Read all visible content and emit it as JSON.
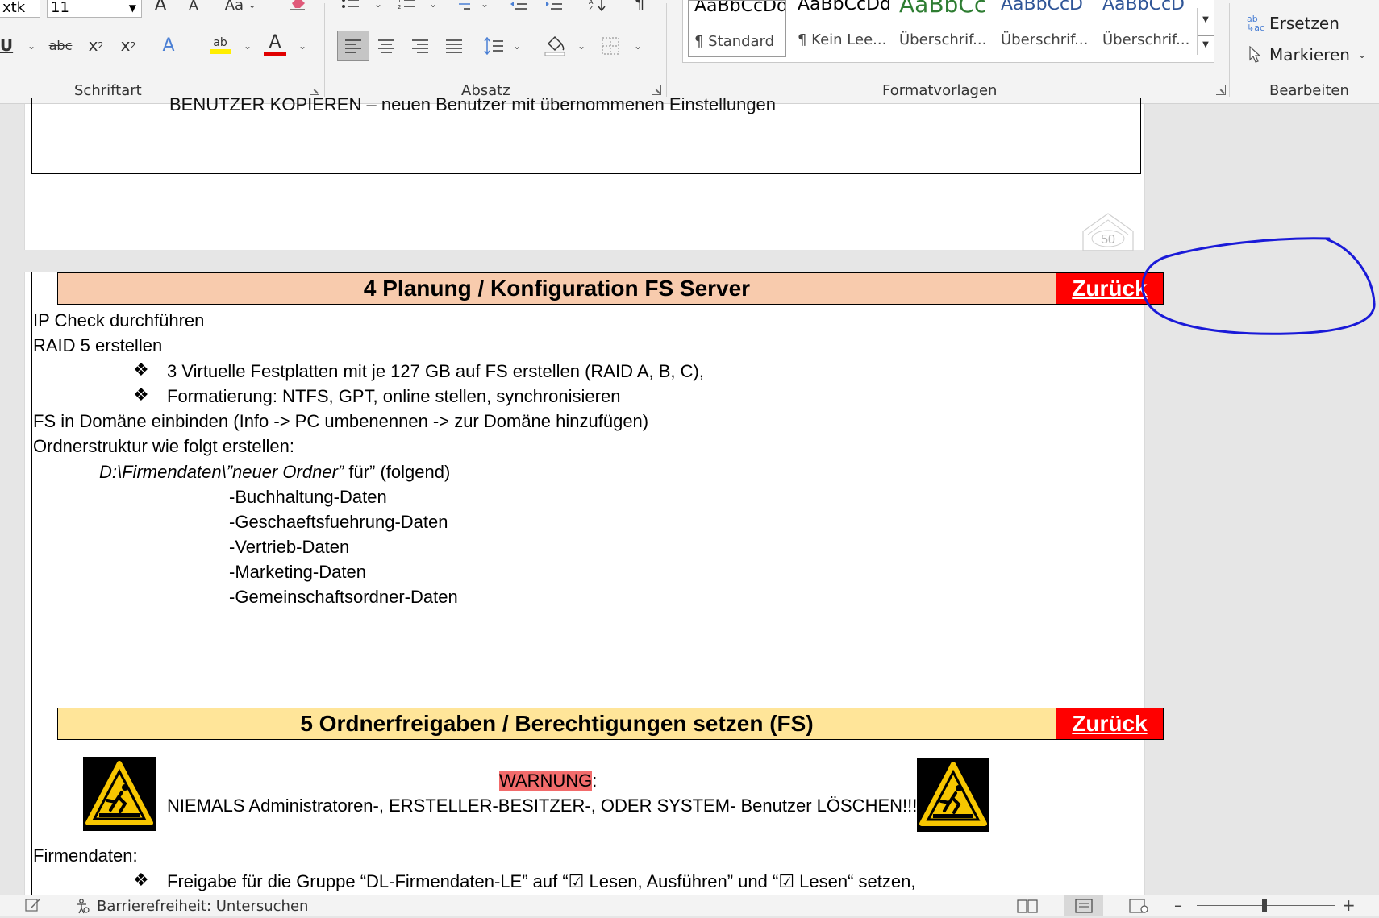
{
  "ribbon": {
    "font_name": "xtk",
    "font_size": "11",
    "groups": {
      "font": "Schriftart",
      "paragraph": "Absatz",
      "styles": "Formatvorlagen",
      "edit": "Bearbeiten"
    },
    "styles_gallery": [
      {
        "sample": "AaBbCcDd",
        "name": "¶ Standard",
        "color": "#000000"
      },
      {
        "sample": "AaBbCcDd",
        "name": "¶ Kein Lee...",
        "color": "#000000"
      },
      {
        "sample": "AaBbCc",
        "name": "Überschrif...",
        "color": "#2e7d32"
      },
      {
        "sample": "AaBbCcD",
        "name": "Überschrif...",
        "color": "#2f5597"
      },
      {
        "sample": "AaBbCcD",
        "name": "Überschrif...",
        "color": "#2f5597"
      }
    ],
    "edit": {
      "replace": "Ersetzen",
      "select": "Markieren"
    },
    "font_glyphs": {
      "grow": "A",
      "shrink": "A",
      "case": "Aa",
      "underline": "U",
      "strike": "abc",
      "subscript": "x",
      "superscript": "x",
      "effects": "A",
      "highlight": "ab",
      "font_color": "A"
    }
  },
  "document": {
    "prev_page": {
      "cut_text": "BENUTZER KOPIEREN – neuen Benutzer mit übernommenen Einstellungen",
      "page_number": "50"
    },
    "section4": {
      "title": "4 Planung / Konfiguration FS Server",
      "back": "Zurück",
      "header_bg": "#f8cbad",
      "lines": {
        "l1": "IP Check durchführen",
        "l2": "RAID 5 erstellen",
        "b1": "3 Virtuelle Festplatten mit je 127 GB auf FS erstellen (RAID A, B, C),",
        "b2": "Formatierung: NTFS, GPT, online stellen, synchronisieren",
        "l3": "FS in Domäne einbinden (Info -> PC umbenennen -> zur Domäne hinzufügen)",
        "l4": "Ordnerstruktur wie folgt erstellen:",
        "path_italic": "D:\\Firmendaten\\”neuer Ordner”",
        "path_rest": " für” (folgend)"
      },
      "folders": [
        "-Buchhaltung-Daten",
        "-Geschaeftsfuehrung-Daten",
        "-Vertrieb-Daten",
        "-Marketing-Daten",
        "-Gemeinschaftsordner-Daten"
      ]
    },
    "section5": {
      "title": "5 Ordnerfreigaben / Berechtigungen setzen (FS)",
      "back": "Zurück",
      "header_bg": "#ffe599",
      "warning_label": "WARNUNG",
      "warning_colon": ":",
      "warning_text": "NIEMALS Administratoren-, ERSTELLER-BESITZER-, ODER SYSTEM- Benutzer LÖSCHEN!!!",
      "firmendaten": "Firmendaten:",
      "bullet1": "Freigabe für die Gruppe “DL-Firmendaten-LE” auf “☑ Lesen, Ausführen” und “☑ Lesen“ setzen,"
    }
  },
  "statusbar": {
    "accessibility": "Barrierefreiheit: Untersuchen",
    "zoom_minus": "–",
    "zoom_plus": "+"
  }
}
